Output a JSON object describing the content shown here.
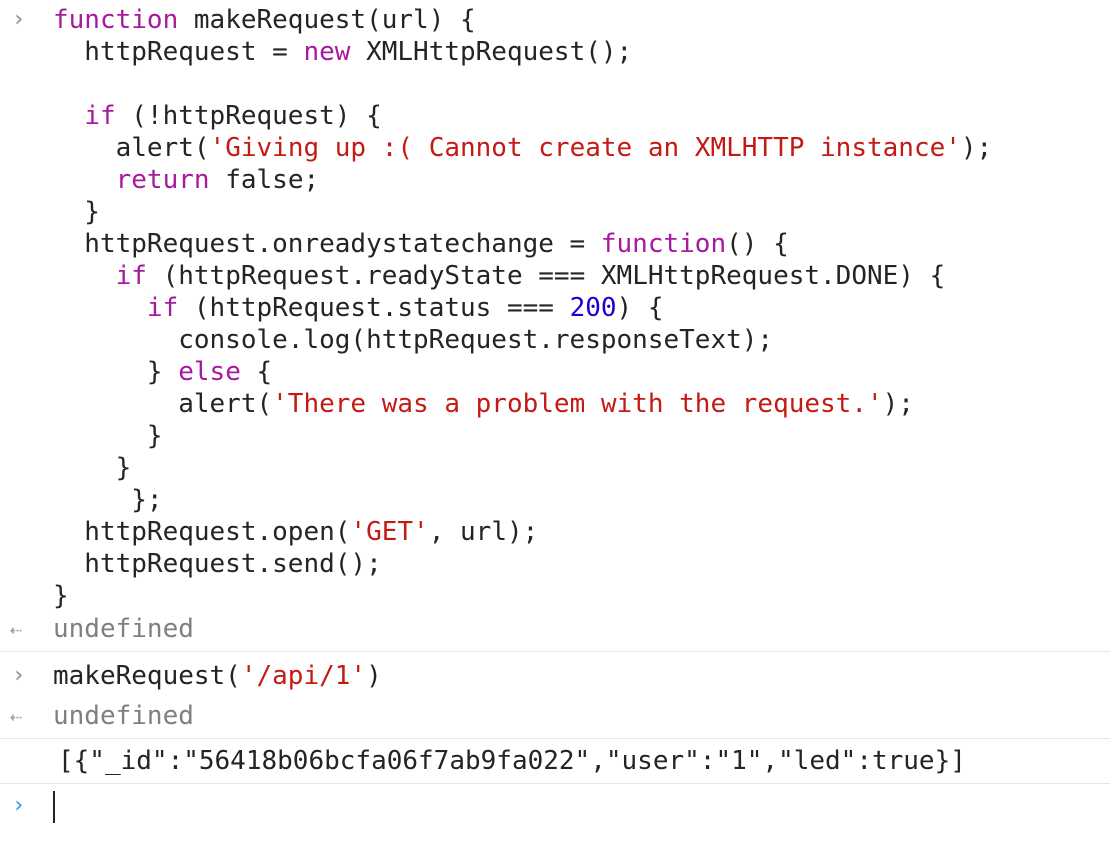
{
  "console": {
    "prompt_icon": "chevron-right-icon",
    "result_icon": "return-arrow-icon",
    "command1": {
      "lines": [
        [
          {
            "t": "kw",
            "s": "function"
          },
          {
            "t": "plain",
            "s": " makeRequest(url) {"
          }
        ],
        [
          {
            "t": "plain",
            "s": "  httpRequest = "
          },
          {
            "t": "kw",
            "s": "new"
          },
          {
            "t": "plain",
            "s": " XMLHttpRequest();"
          }
        ],
        [
          {
            "t": "plain",
            "s": ""
          }
        ],
        [
          {
            "t": "plain",
            "s": "  "
          },
          {
            "t": "kw",
            "s": "if"
          },
          {
            "t": "plain",
            "s": " (!httpRequest) {"
          }
        ],
        [
          {
            "t": "plain",
            "s": "    alert("
          },
          {
            "t": "str",
            "s": "'Giving up :( Cannot create an XMLHTTP instance'"
          },
          {
            "t": "plain",
            "s": ");"
          }
        ],
        [
          {
            "t": "plain",
            "s": "    "
          },
          {
            "t": "kw",
            "s": "return"
          },
          {
            "t": "plain",
            "s": " false;"
          }
        ],
        [
          {
            "t": "plain",
            "s": "  }"
          }
        ],
        [
          {
            "t": "plain",
            "s": "  httpRequest.onreadystatechange = "
          },
          {
            "t": "kw",
            "s": "function"
          },
          {
            "t": "plain",
            "s": "() {"
          }
        ],
        [
          {
            "t": "plain",
            "s": "    "
          },
          {
            "t": "kw",
            "s": "if"
          },
          {
            "t": "plain",
            "s": " (httpRequest.readyState === XMLHttpRequest.DONE) {"
          }
        ],
        [
          {
            "t": "plain",
            "s": "      "
          },
          {
            "t": "kw",
            "s": "if"
          },
          {
            "t": "plain",
            "s": " (httpRequest.status === "
          },
          {
            "t": "num",
            "s": "200"
          },
          {
            "t": "plain",
            "s": ") {"
          }
        ],
        [
          {
            "t": "plain",
            "s": "        console.log(httpRequest.responseText);"
          }
        ],
        [
          {
            "t": "plain",
            "s": "      } "
          },
          {
            "t": "kw",
            "s": "else"
          },
          {
            "t": "plain",
            "s": " {"
          }
        ],
        [
          {
            "t": "plain",
            "s": "        alert("
          },
          {
            "t": "str",
            "s": "'There was a problem with the request.'"
          },
          {
            "t": "plain",
            "s": ");"
          }
        ],
        [
          {
            "t": "plain",
            "s": "      }"
          }
        ],
        [
          {
            "t": "plain",
            "s": "    }"
          }
        ],
        [
          {
            "t": "plain",
            "s": "     };"
          }
        ],
        [
          {
            "t": "plain",
            "s": "  httpRequest.open("
          },
          {
            "t": "str",
            "s": "'GET'"
          },
          {
            "t": "plain",
            "s": ", url);"
          }
        ],
        [
          {
            "t": "plain",
            "s": "  httpRequest.send();"
          }
        ],
        [
          {
            "t": "plain",
            "s": "}"
          }
        ]
      ]
    },
    "result1": "undefined",
    "command2": {
      "lines": [
        [
          {
            "t": "plain",
            "s": "makeRequest("
          },
          {
            "t": "str",
            "s": "'/api/1'"
          },
          {
            "t": "plain",
            "s": ")"
          }
        ]
      ]
    },
    "result2": "undefined",
    "log_output": "[{\"_id\":\"56418b06bcfa06f7ab9fa022\",\"user\":\"1\",\"led\":true}]",
    "input_value": ""
  }
}
